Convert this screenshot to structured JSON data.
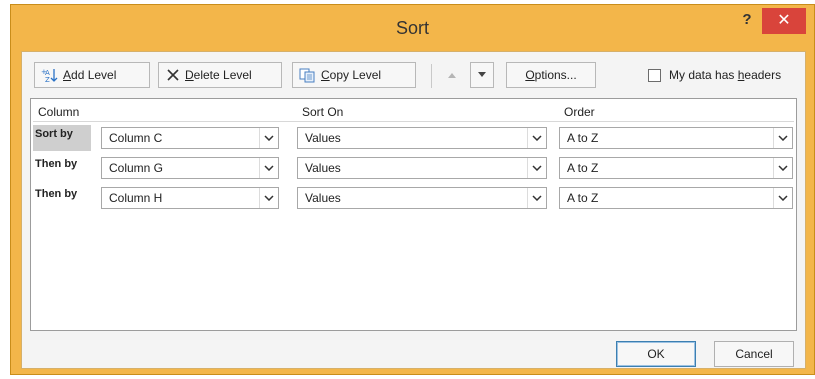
{
  "window": {
    "title": "Sort",
    "help_label": "?",
    "close_label": "✕"
  },
  "toolbar": {
    "add_level": {
      "mnemonic": "A",
      "rest": "dd Level",
      "icon": "add-level-icon"
    },
    "delete_level": {
      "mnemonic": "D",
      "rest": "elete Level",
      "icon": "delete-x-icon"
    },
    "copy_level": {
      "mnemonic": "C",
      "rest": "opy Level",
      "icon": "copy-icon"
    },
    "move_up": {
      "icon": "arrow-up-icon"
    },
    "move_down": {
      "icon": "arrow-down-icon"
    },
    "options": {
      "mnemonic": "O",
      "rest": "ptions..."
    },
    "headers_checkbox": {
      "prefix": "My data has ",
      "mnemonic": "h",
      "rest": "eaders",
      "checked": false
    }
  },
  "grid": {
    "headers": {
      "column": "Column",
      "sort_on": "Sort On",
      "order": "Order"
    },
    "rows": [
      {
        "label": "Sort by",
        "column": "Column C",
        "sort_on": "Values",
        "order": "A to Z",
        "selected": true
      },
      {
        "label": "Then by",
        "column": "Column G",
        "sort_on": "Values",
        "order": "A to Z",
        "selected": false
      },
      {
        "label": "Then by",
        "column": "Column H",
        "sort_on": "Values",
        "order": "A to Z",
        "selected": false
      }
    ]
  },
  "buttons": {
    "ok": "OK",
    "cancel": "Cancel"
  },
  "colors": {
    "frame": "#f3b64a",
    "close": "#d9443b",
    "ok_border": "#3c7fb1"
  }
}
